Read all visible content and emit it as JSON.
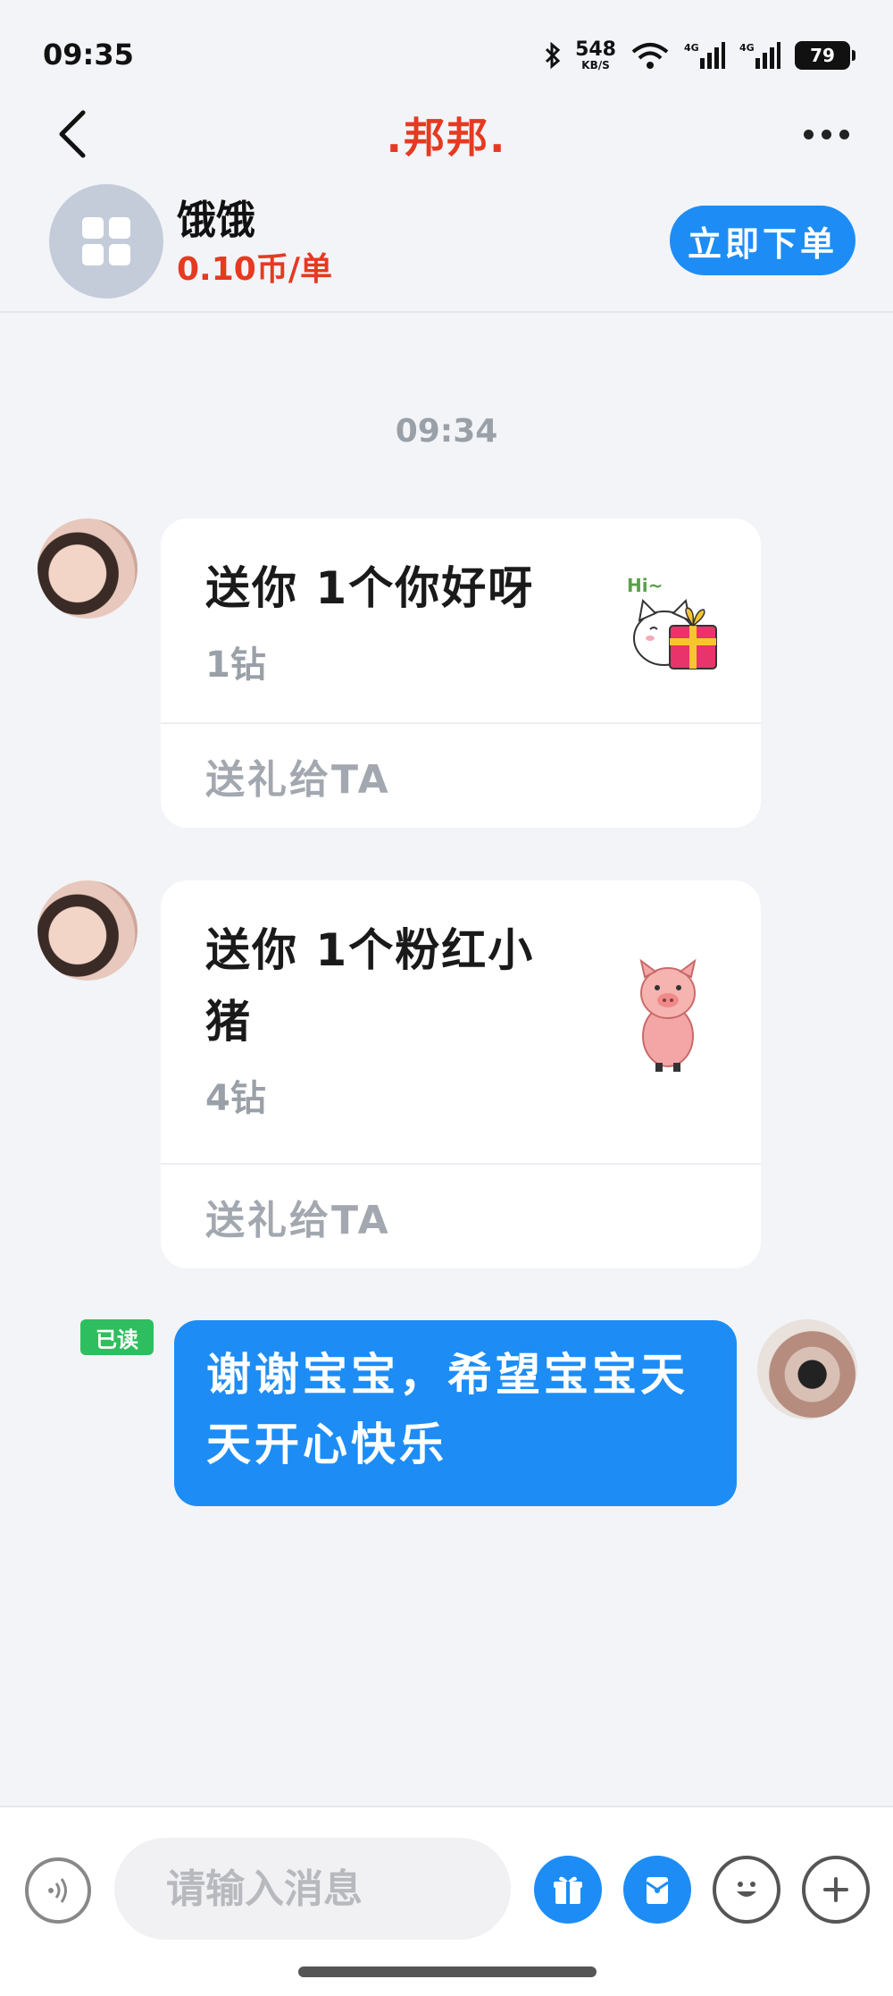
{
  "status_bar": {
    "time": "09:35",
    "speed_value": "548",
    "speed_unit": "KB/S",
    "battery_level": "79"
  },
  "nav": {
    "title": ".邦邦."
  },
  "profile": {
    "name": "饿饿",
    "price": "0.10币/单",
    "order_button": "立即下单"
  },
  "chat": {
    "timestamp": "09:34",
    "gift_messages": [
      {
        "title": "送你 1个你好呀",
        "price": "1钻",
        "action": "送礼给TA",
        "sticker_text": "Hi~",
        "icon": "cat-with-gift-icon"
      },
      {
        "title": "送你 1个粉红小猪",
        "price": "4钻",
        "action": "送礼给TA",
        "icon": "pink-pig-icon"
      }
    ],
    "my_message": {
      "read_status": "已读",
      "text": "谢谢宝宝，希望宝宝天天开心快乐"
    }
  },
  "input_bar": {
    "placeholder": "请输入消息"
  },
  "colors": {
    "accent_blue": "#1d8df5",
    "brand_red": "#e53a22",
    "read_green": "#2fbe5f"
  }
}
